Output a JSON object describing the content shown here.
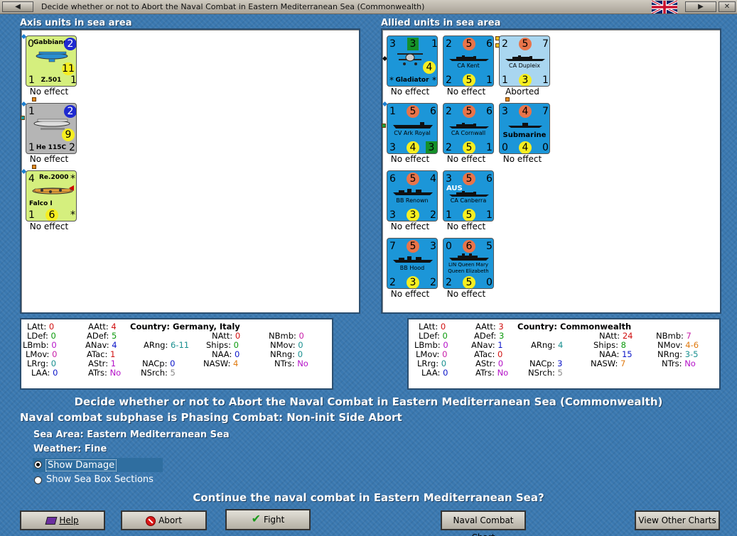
{
  "window": {
    "title": "Decide whether or not to Abort the Naval Combat in Eastern Mediterranean Sea (Commonwealth)"
  },
  "axis": {
    "header": "Axis units in sea area",
    "units": [
      {
        "name": "Gabbiano",
        "sub": "Z.501",
        "status": "No effect",
        "tl": "0",
        "tr": "2",
        "mr": "11",
        "bl": "1",
        "br": "1"
      },
      {
        "name": "He 115C",
        "status": "No effect",
        "tl": "1",
        "tr": "2",
        "mr": "9",
        "bl": "1",
        "br": "2"
      },
      {
        "name": "Re.2000",
        "sub": "Falco I",
        "status": "No effect",
        "tl": "4",
        "tr": "*",
        "bl": "1",
        "bm": "6",
        "br": "*"
      }
    ]
  },
  "allied": {
    "header": "Allied units in sea area",
    "units": [
      {
        "name": "Gladiator",
        "status": "No effect",
        "tl": "3",
        "tm": "3",
        "tr": "1",
        "mr": "4",
        "bl": "*",
        "br": "*"
      },
      {
        "name": "CA Kent",
        "status": "No effect",
        "tl": "2",
        "tm": "5",
        "tr": "6",
        "bl": "2",
        "bm": "5",
        "br": "1"
      },
      {
        "name": "CA Dupleix",
        "status": "Aborted",
        "tl": "2",
        "tm": "5",
        "tr": "7",
        "bl": "1",
        "bm": "3",
        "br": "1"
      },
      {
        "name": "CV Ark Royal",
        "status": "No effect",
        "tl": "1",
        "tm": "5",
        "tr": "6",
        "bl": "3",
        "bm": "4",
        "br": "3"
      },
      {
        "name": "CA Cornwall",
        "status": "No effect",
        "tl": "2",
        "tm": "5",
        "tr": "6",
        "bl": "2",
        "bm": "5",
        "br": "1"
      },
      {
        "name": "Submarine",
        "status": "No effect",
        "tl": "3",
        "tm": "4",
        "tr": "7",
        "bl": "0",
        "bm": "4",
        "br": "0"
      },
      {
        "name": "BB Renown",
        "status": "No effect",
        "tl": "6",
        "tm": "5",
        "tr": "4",
        "bl": "3",
        "bm": "3",
        "br": "2"
      },
      {
        "name": "CA Canberra",
        "badge": "AUS",
        "status": "No effect",
        "tl": "3",
        "tm": "5",
        "tr": "6",
        "bl": "1",
        "bm": "5",
        "br": "1"
      },
      {
        "name": "BB Hood",
        "status": "No effect",
        "tl": "7",
        "tm": "5",
        "tr": "3",
        "bl": "2",
        "bm": "3",
        "br": "2"
      },
      {
        "name": "LIN Queen Mary",
        "name2": "Queen Elizabeth",
        "status": "No effect",
        "tl": "0",
        "tm": "6",
        "tr": "5",
        "bl": "2",
        "bm": "5",
        "br": "0"
      }
    ]
  },
  "axis_stats": {
    "country_label": "Country:",
    "country": "Germany, Italy",
    "LAtt": "0",
    "LDef": "0",
    "LBmb": "0",
    "LMov": "0",
    "LRrg": "0",
    "LAA": "0",
    "AAtt": "4",
    "ADef": "5",
    "ANav": "4",
    "ATac": "1",
    "AStr": "1",
    "ATrs": "No",
    "ARng": "6-11",
    "NAtt": "0",
    "Ships": "0",
    "NAA": "0",
    "NASW": "4",
    "NACp": "0",
    "NSrch": "5",
    "NBmb": "0",
    "NMov": "0",
    "NRng": "0",
    "NTrs": "No"
  },
  "allied_stats": {
    "country_label": "Country:",
    "country": "Commonwealth",
    "LAtt": "0",
    "LDef": "0",
    "LBmb": "0",
    "LMov": "0",
    "LRrg": "0",
    "LAA": "0",
    "AAtt": "3",
    "ADef": "3",
    "ANav": "1",
    "ATac": "0",
    "AStr": "0",
    "ATrs": "No",
    "ARng": "4",
    "NAtt": "24",
    "Ships": "8",
    "NAA": "15",
    "NASW": "7",
    "NACp": "3",
    "NSrch": "5",
    "NBmb": "7",
    "NMov": "4-6",
    "NRng": "3-5",
    "NTrs": "No"
  },
  "main": {
    "heading": "Decide whether or not to Abort the Naval Combat in Eastern Mediterranean Sea (Commonwealth)",
    "subphase": "Naval combat subphase is Phasing Combat: Non-init Side Abort",
    "sea_area_label": "Sea Area:",
    "sea_area": "Eastern Mediterranean Sea",
    "weather_label": "Weather:",
    "weather": "Fine",
    "show_damage": "Show Damage",
    "show_sections": "Show Sea Box Sections",
    "question": "Continue the naval combat in Eastern Mediterranean Sea?"
  },
  "buttons": {
    "help": "Help",
    "abort": "Abort",
    "fight": "Fight",
    "naval_chart": "Naval Combat Chart",
    "other_charts": "View Other Charts"
  },
  "colors": {
    "stat_red": "#d01010",
    "stat_green": "#0c9a0c",
    "stat_blue": "#0a14c8",
    "stat_purple": "#b412c8",
    "accent_panel": "#3a78b0"
  }
}
